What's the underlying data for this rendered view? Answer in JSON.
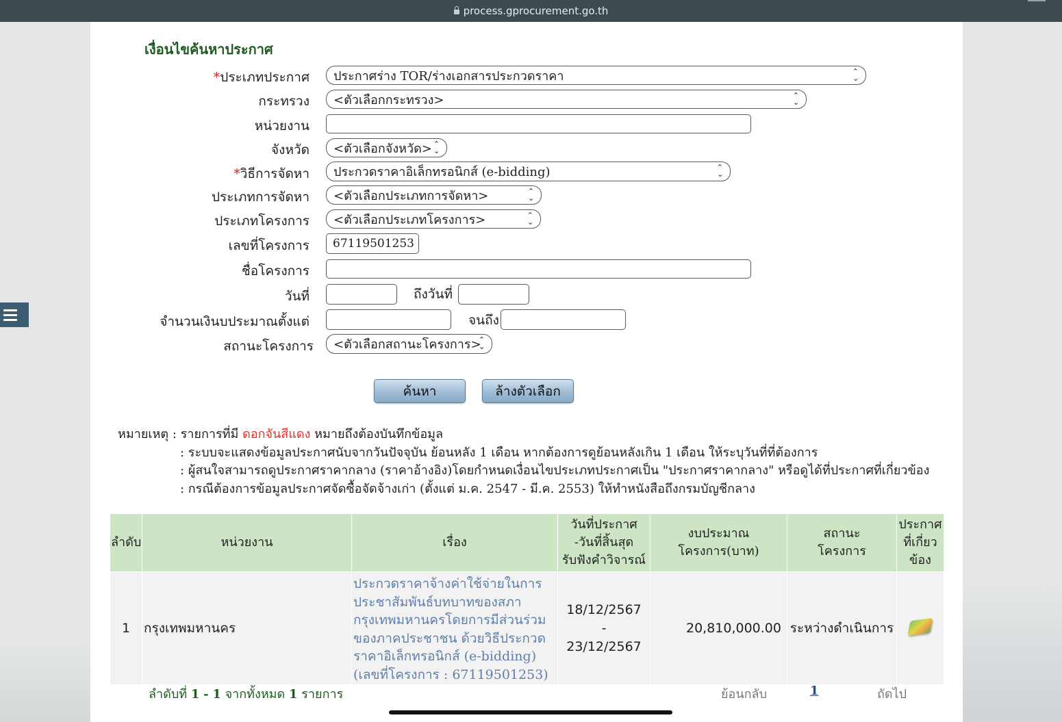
{
  "browser": {
    "url": "process.gprocurement.go.th"
  },
  "form": {
    "title": "เงื่อนไขค้นหาประกาศ",
    "announce_type": {
      "label": "ประเภทประกาศ",
      "value": "ประกาศร่าง TOR/ร่างเอกสารประกวดราคา"
    },
    "ministry": {
      "label": "กระทรวง",
      "value": "<ตัวเลือกกระทรวง>"
    },
    "agency": {
      "label": "หน่วยงาน",
      "value": ""
    },
    "province": {
      "label": "จังหวัด",
      "value": "<ตัวเลือกจังหวัด>"
    },
    "method": {
      "label": "วิธีการจัดหา",
      "value": "ประกวดราคาอิเล็กทรอนิกส์ (e-bidding)"
    },
    "procure_type": {
      "label": "ประเภทการจัดหา",
      "value": "<ตัวเลือกประเภทการจัดหา>"
    },
    "project_type": {
      "label": "ประเภทโครงการ",
      "value": "<ตัวเลือกประเภทโครงการ>"
    },
    "project_no": {
      "label": "เลขที่โครงการ",
      "value": "67119501253"
    },
    "project_name": {
      "label": "ชื่อโครงการ",
      "value": ""
    },
    "date": {
      "label": "วันที่",
      "to_label": "ถึงวันที่",
      "from": "",
      "to": ""
    },
    "budget": {
      "label": "จำนวนเงินบประมาณตั้งแต่",
      "to_label": "จนถึง",
      "from": "",
      "to": ""
    },
    "status": {
      "label": "สถานะโครงการ",
      "value": "<ตัวเลือกสถานะโครงการ>"
    },
    "search_button": "ค้นหา",
    "clear_button": "ล้างตัวเลือก"
  },
  "notes": {
    "prefix": "หมายเหตุ :",
    "line1_a": "รายการที่มี",
    "line1_red": "ดอกจันสีแดง",
    "line1_b": "หมายถึงต้องบันทึกข้อมูล",
    "line2": ": ระบบจะแสดงข้อมูลประกาศนับจากวันปัจจุบัน ย้อนหลัง 1 เดือน หากต้องการดูย้อนหลังเกิน 1 เดือน ให้ระบุวันที่ที่ต้องการ",
    "line3": ": ผู้สนใจสามารถดูประกาศราคากลาง (ราคาอ้างอิง)โดยกำหนดเงื่อนไขประเภทประกาศเป็น \"ประกาศราคากลาง\" หรือดูได้ที่ประกาศที่เกี่ยวข้อง",
    "line4": ": กรณีต้องการข้อมูลประกาศจัดซื้อจัดจ้างเก่า (ตั้งแต่ ม.ค. 2547 - มี.ค. 2553) ให้ทำหนังสือถึงกรมบัญชีกลาง"
  },
  "table": {
    "headers": {
      "no": "ลำดับ",
      "agency": "หน่วยงาน",
      "subject": "เรื่อง",
      "date_l1": "วันที่ประกาศ",
      "date_l2": "-วันที่สิ้นสุด",
      "date_l3": "รับฟังคำวิจารณ์",
      "budget_l1": "งบประมาณ",
      "budget_l2": "โครงการ(บาท)",
      "status_l1": "สถานะ",
      "status_l2": "โครงการ",
      "related_l1": "ประกาศ",
      "related_l2": "ที่เกี่ยว",
      "related_l3": "ข้อง"
    },
    "rows": [
      {
        "no": "1",
        "agency": "กรุงเทพมหานคร",
        "subject": "ประกวดราคาจ้างค่าใช้จ่ายในการประชาสัมพันธ์บทบาทของสภากรุงเทพมหานครโดยการมีส่วนร่วมของภาคประชาชน ด้วยวิธีประกวดราคาอิเล็กทรอนิกส์ (e-bidding) (เลขที่โครงการ : 67119501253)",
        "date_start": "18/12/2567",
        "date_sep": "-",
        "date_end": "23/12/2567",
        "budget": "20,810,000.00",
        "status": "ระหว่างดำเนินการ",
        "related_icon": "document-gem-icon"
      }
    ]
  },
  "pager": {
    "summary_a": "ลำดับที่",
    "from": "1",
    "dash": "-",
    "to": "1",
    "summary_b": "จากทั้งหมด",
    "total": "1",
    "summary_c": "รายการ",
    "prev": "ย้อนกลับ",
    "page": "1",
    "next": "ถัดไป"
  },
  "colors": {
    "header_green": "#cde5c4",
    "title_green": "#1f5a22",
    "required_red": "#cc1f1f",
    "link_blue": "#5f7fa8"
  }
}
